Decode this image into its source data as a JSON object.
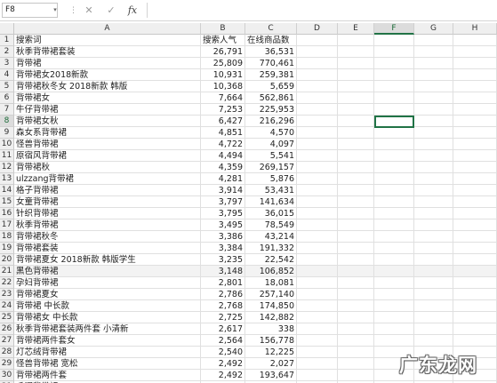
{
  "formula_bar": {
    "name_box": "F8",
    "cancel_glyph": "✕",
    "enter_glyph": "✓",
    "fx_label": "fx",
    "formula_value": ""
  },
  "columns": [
    "A",
    "B",
    "C",
    "D",
    "E",
    "F",
    "G",
    "H"
  ],
  "active_column": "F",
  "active_row": 8,
  "header_row": {
    "row_number": "1",
    "keyword": "搜索词",
    "popularity": "搜索人气",
    "online_products": "在线商品数"
  },
  "rows": [
    {
      "n": "2",
      "a": "秋季背带裙套装",
      "b": "26,791",
      "c": "36,531"
    },
    {
      "n": "3",
      "a": "背带裙",
      "b": "25,809",
      "c": "770,461"
    },
    {
      "n": "4",
      "a": "背带裙女2018新款",
      "b": "10,931",
      "c": "259,381"
    },
    {
      "n": "5",
      "a": "背带裙秋冬女 2018新款 韩版",
      "b": "10,368",
      "c": "5,659"
    },
    {
      "n": "6",
      "a": "背带裙女",
      "b": "7,664",
      "c": "562,861"
    },
    {
      "n": "7",
      "a": "牛仔背带裙",
      "b": "7,253",
      "c": "225,953"
    },
    {
      "n": "8",
      "a": "背带裙女秋",
      "b": "6,427",
      "c": "216,296"
    },
    {
      "n": "9",
      "a": "森女系背带裙",
      "b": "4,851",
      "c": "4,570"
    },
    {
      "n": "10",
      "a": "怪兽背带裙",
      "b": "4,722",
      "c": "4,097"
    },
    {
      "n": "11",
      "a": "原宿风背带裙",
      "b": "4,494",
      "c": "5,541"
    },
    {
      "n": "12",
      "a": "背带裙秋",
      "b": "4,359",
      "c": "269,157"
    },
    {
      "n": "13",
      "a": "ulzzang背带裙",
      "b": "4,281",
      "c": "5,876"
    },
    {
      "n": "14",
      "a": "格子背带裙",
      "b": "3,914",
      "c": "53,431"
    },
    {
      "n": "15",
      "a": "女童背带裙",
      "b": "3,797",
      "c": "141,634"
    },
    {
      "n": "16",
      "a": "针织背带裙",
      "b": "3,795",
      "c": "36,015"
    },
    {
      "n": "17",
      "a": "秋季背带裙",
      "b": "3,495",
      "c": "78,549"
    },
    {
      "n": "18",
      "a": "背带裙秋冬",
      "b": "3,386",
      "c": "43,214"
    },
    {
      "n": "19",
      "a": "背带裙套装",
      "b": "3,384",
      "c": "191,332"
    },
    {
      "n": "20",
      "a": "背带裙夏女 2018新款 韩版学生",
      "b": "3,235",
      "c": "22,542"
    },
    {
      "n": "21",
      "a": "黑色背带裙",
      "b": "3,148",
      "c": "106,852"
    },
    {
      "n": "22",
      "a": "孕妇背带裙",
      "b": "2,801",
      "c": "18,081"
    },
    {
      "n": "23",
      "a": "背带裙夏女",
      "b": "2,786",
      "c": "257,140"
    },
    {
      "n": "24",
      "a": "背带裙 中长款",
      "b": "2,768",
      "c": "174,850"
    },
    {
      "n": "25",
      "a": "背带裙女 中长款",
      "b": "2,725",
      "c": "142,882"
    },
    {
      "n": "26",
      "a": "秋季背带裙套装两件套 小清新",
      "b": "2,617",
      "c": "338"
    },
    {
      "n": "27",
      "a": "背带裙两件套女",
      "b": "2,564",
      "c": "156,778"
    },
    {
      "n": "28",
      "a": "灯芯绒背带裙",
      "b": "2,540",
      "c": "12,225"
    },
    {
      "n": "29",
      "a": "怪兽背带裙 宽松",
      "b": "2,492",
      "c": "2,027"
    },
    {
      "n": "30",
      "a": "背带裙两件套",
      "b": "2,492",
      "c": "193,647"
    },
    {
      "n": "31",
      "a": "毛呢背带裙",
      "b": "2,366",
      "c": "19,452"
    }
  ],
  "watermark": {
    "text": "广东龙网"
  }
}
